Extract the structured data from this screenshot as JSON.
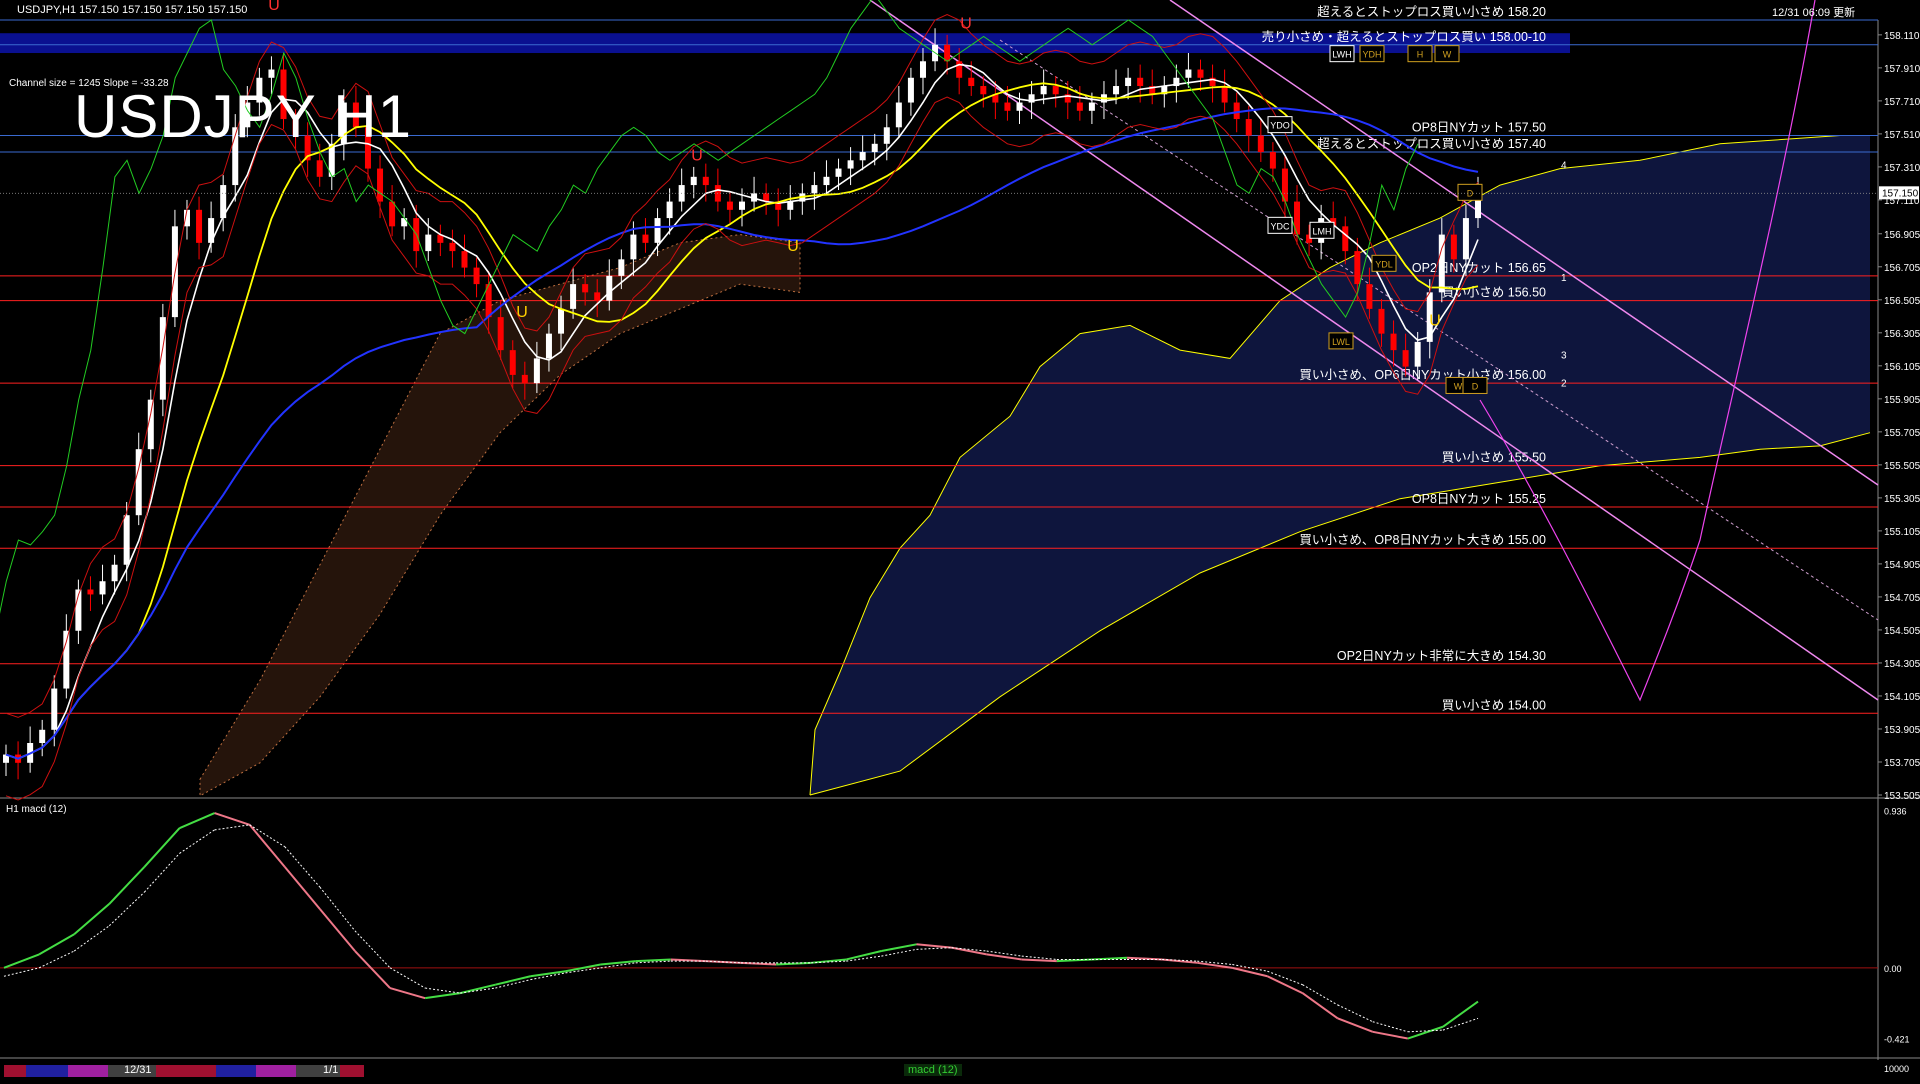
{
  "header": {
    "symbol": "USDJPY,H1  157.150 157.150 157.150 157.150",
    "timestamp": "12/31 06:09 更新",
    "chart_title": "USDJPY H1",
    "channel_info": "Channel size = 1245 Slope = -33.28"
  },
  "chart_data": [
    {
      "type": "candlestick",
      "title": "USDJPY H1",
      "symbol": "USDJPY",
      "timeframe": "H1",
      "last_price": "157.150",
      "ylim": [
        153.505,
        158.2
      ],
      "y_ticks": [
        "158.110",
        "157.910",
        "157.710",
        "157.510",
        "157.310",
        "157.110",
        "156.905",
        "156.705",
        "156.505",
        "156.305",
        "156.105",
        "155.905",
        "155.705",
        "155.505",
        "155.305",
        "155.105",
        "154.905",
        "154.705",
        "154.505",
        "154.305",
        "154.105",
        "153.905",
        "153.705",
        "153.505"
      ],
      "x_labels": [
        "12/31",
        "1/1"
      ],
      "closes": [
        153.75,
        153.7,
        153.82,
        153.9,
        154.15,
        154.5,
        154.75,
        154.72,
        154.8,
        154.9,
        155.2,
        155.6,
        155.9,
        156.4,
        156.95,
        157.05,
        156.85,
        157.0,
        157.2,
        157.55,
        157.7,
        157.85,
        157.9,
        157.6,
        157.5,
        157.35,
        157.25,
        157.45,
        157.7,
        157.55,
        157.3,
        157.1,
        156.95,
        157.0,
        156.8,
        156.9,
        156.85,
        156.8,
        156.7,
        156.6,
        156.4,
        156.2,
        156.05,
        156.0,
        156.15,
        156.3,
        156.45,
        156.6,
        156.55,
        156.5,
        156.65,
        156.75,
        156.9,
        156.85,
        157.0,
        157.1,
        157.2,
        157.25,
        157.2,
        157.1,
        157.05,
        157.1,
        157.15,
        157.1,
        157.05,
        157.1,
        157.15,
        157.2,
        157.25,
        157.3,
        157.35,
        157.4,
        157.45,
        157.55,
        157.7,
        157.85,
        157.95,
        158.05,
        157.95,
        157.85,
        157.8,
        157.75,
        157.7,
        157.65,
        157.7,
        157.75,
        157.8,
        157.75,
        157.7,
        157.65,
        157.7,
        157.75,
        157.8,
        157.85,
        157.8,
        157.75,
        157.8,
        157.85,
        157.9,
        157.85,
        157.8,
        157.7,
        157.6,
        157.5,
        157.4,
        157.3,
        157.1,
        156.9,
        156.85,
        157.0,
        156.95,
        156.8,
        156.6,
        156.45,
        156.3,
        156.2,
        156.1,
        156.25,
        156.55,
        156.9,
        156.75,
        157.0,
        157.15
      ],
      "horizontal_levels": [
        {
          "price": 158.2,
          "label": "超えるとストップロス買い小さめ 158.20"
        },
        {
          "price": 158.05,
          "label": "売り小さめ・超えるとストップロス買い 158.00-10"
        },
        {
          "price": 157.5,
          "label": "OP8日NYカット 157.50"
        },
        {
          "price": 157.4,
          "label": "超えるとストップロス買い小さめ 157.40"
        },
        {
          "price": 156.65,
          "label": "OP2日NYカット 156.65"
        },
        {
          "price": 156.5,
          "label": "買い小さめ 156.50"
        },
        {
          "price": 156.0,
          "label": "買い小さめ、OP6日NYカット小さめ 156.00"
        },
        {
          "price": 155.5,
          "label": "買い小さめ 155.50"
        },
        {
          "price": 155.25,
          "label": "OP8日NYカット 155.25"
        },
        {
          "price": 155.0,
          "label": "買い小さめ、OP8日NYカット大きめ 155.00"
        },
        {
          "price": 154.3,
          "label": "OP2日NYカット非常に大きめ 154.30"
        },
        {
          "price": 154.0,
          "label": "買い小さめ 154.00"
        }
      ],
      "markers": [
        "LWH",
        "YDH",
        "H",
        "W",
        "YDO",
        "YDC",
        "LMH",
        "YDL",
        "LWL",
        "D",
        "W",
        "D",
        "1",
        "2",
        "3",
        "4"
      ]
    },
    {
      "type": "line",
      "title": "H1 macd (12)",
      "y_ticks": [
        "0.936",
        "0.00",
        "-0.421"
      ],
      "ylim": [
        -0.5,
        0.95
      ],
      "series_main": [
        0.0,
        0.08,
        0.2,
        0.38,
        0.6,
        0.83,
        0.92,
        0.85,
        0.6,
        0.35,
        0.1,
        -0.12,
        -0.18,
        -0.15,
        -0.1,
        -0.05,
        -0.02,
        0.02,
        0.04,
        0.05,
        0.04,
        0.03,
        0.02,
        0.03,
        0.05,
        0.1,
        0.14,
        0.12,
        0.08,
        0.05,
        0.04,
        0.05,
        0.06,
        0.05,
        0.03,
        0.0,
        -0.05,
        -0.15,
        -0.3,
        -0.38,
        -0.42,
        -0.35,
        -0.2
      ],
      "series_signal": [
        -0.05,
        0.0,
        0.1,
        0.25,
        0.45,
        0.68,
        0.82,
        0.85,
        0.72,
        0.48,
        0.22,
        0.0,
        -0.12,
        -0.15,
        -0.12,
        -0.07,
        -0.03,
        0.0,
        0.03,
        0.04,
        0.04,
        0.03,
        0.03,
        0.03,
        0.04,
        0.07,
        0.11,
        0.12,
        0.1,
        0.07,
        0.05,
        0.05,
        0.05,
        0.05,
        0.04,
        0.02,
        -0.02,
        -0.1,
        -0.22,
        -0.32,
        -0.38,
        -0.37,
        -0.3
      ]
    }
  ],
  "bottom": {
    "date1": "12/31",
    "date2": "1/1",
    "tab": "macd (12)",
    "right_value": "10000"
  },
  "colors": {
    "background": "#000000",
    "bull_candle": "#ffffff",
    "bear_candle": "#ff0000",
    "level_line": "#ff2020",
    "cloud": "#3a4a9a",
    "tenkan": "#ffffff",
    "kijun": "#ffff00",
    "ma_blue": "#2233ff",
    "chikou": "#22cc22",
    "channel": "#ee88ee",
    "macd_up": "#44dd44",
    "macd_down": "#ee7788"
  }
}
